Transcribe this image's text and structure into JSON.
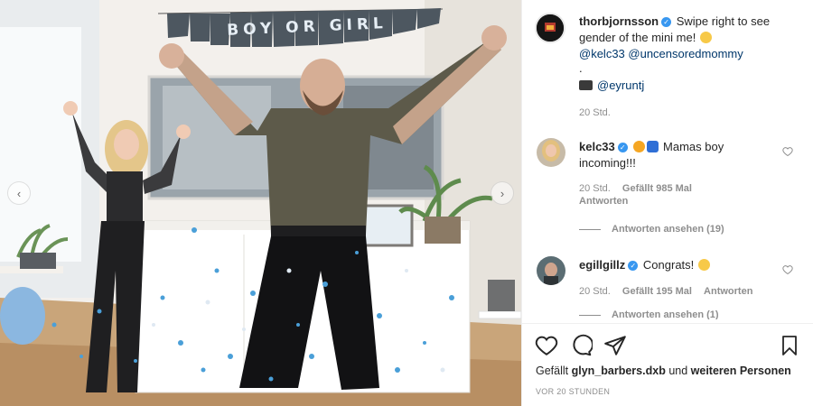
{
  "post": {
    "author": "thorbjornsson",
    "caption": "Swipe right to see gender of the mini me!",
    "mentions_line": "@kelc33 @uncensoredmommy",
    "dot_line": ".",
    "photo_credit": "@eyruntj",
    "age": "20 Std.",
    "banner_text": "BOY  OR  GIRL",
    "likes_prefix": "Gefällt",
    "likes_user": "glyn_barbers.dxb",
    "likes_connector": "und",
    "likes_rest": "weiteren Personen",
    "timestamp": "VOR 20 STUNDEN"
  },
  "comments": [
    {
      "user": "kelc33",
      "text_line1": "Mamas boy",
      "text_line2": "incoming!!!",
      "age": "20 Std.",
      "likes": "Gefällt 985 Mal",
      "reply": "Antworten",
      "view_replies": "Antworten ansehen (19)"
    },
    {
      "user": "egillgillz",
      "text": "Congrats!",
      "age": "20 Std.",
      "likes": "Gefällt 195 Mal",
      "reply": "Antworten",
      "view_replies": "Antworten ansehen (1)"
    }
  ],
  "colors": {
    "verified": "#3897f0",
    "link": "#00376b",
    "meta": "#8e8e8e",
    "confetti_blue": "#4a9fd8"
  },
  "icons": [
    "verified-badge-icon",
    "heart-icon",
    "comment-icon",
    "share-icon",
    "bookmark-icon",
    "chevron-left-icon",
    "chevron-right-icon",
    "camera-emoji-icon"
  ]
}
